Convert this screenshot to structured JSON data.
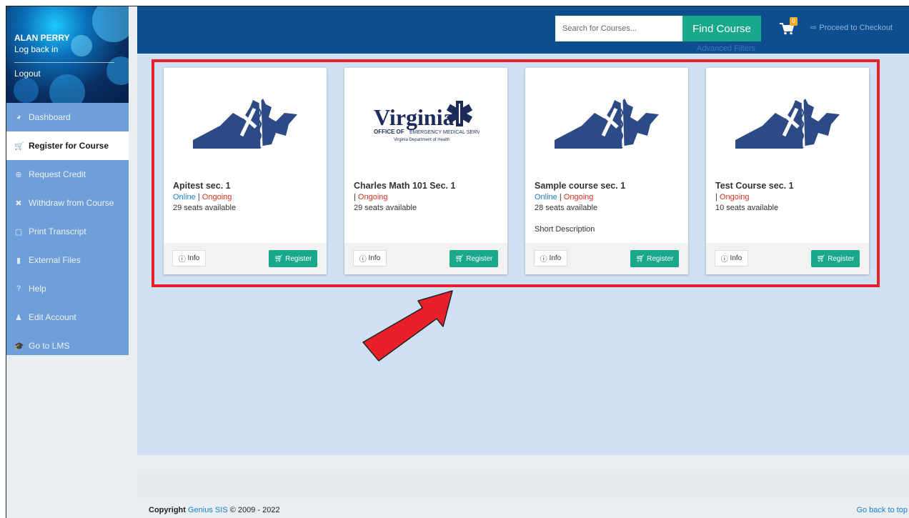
{
  "user": {
    "name": "ALAN PERRY",
    "log_back": "Log back in",
    "logout": "Logout"
  },
  "sidebar": {
    "items": [
      {
        "label": "Dashboard",
        "icon": "dashboard-icon",
        "glyph": "◕",
        "active": false
      },
      {
        "label": "Register for Course",
        "icon": "cart-icon",
        "glyph": "🛒",
        "active": true
      },
      {
        "label": "Request Credit",
        "icon": "plus-circle-icon",
        "glyph": "⊕",
        "active": false
      },
      {
        "label": "Withdraw from Course",
        "icon": "x-icon",
        "glyph": "✖",
        "active": false
      },
      {
        "label": "Print Transcript",
        "icon": "pdf-icon",
        "glyph": "▢",
        "active": false
      },
      {
        "label": "External Files",
        "icon": "file-icon",
        "glyph": "▮",
        "active": false
      },
      {
        "label": "Help",
        "icon": "question-icon",
        "glyph": "?",
        "active": false
      },
      {
        "label": "Edit Account",
        "icon": "user-icon",
        "glyph": "♟",
        "active": false
      },
      {
        "label": "Go to LMS",
        "icon": "graduation-cap-icon",
        "glyph": "🎓",
        "active": false
      }
    ]
  },
  "header": {
    "search_placeholder": "Search for Courses...",
    "find_label": "Find Course",
    "advanced_filters": "Advanced Filters",
    "cart_count": "0",
    "checkout": "Proceed to Checkout"
  },
  "courses": [
    {
      "title": "Apitest sec. 1",
      "online": "Online",
      "ongoing": "Ongoing",
      "seats": "29 seats available",
      "description": "",
      "logo": "va-map-logo"
    },
    {
      "title": "Charles Math 101 Sec. 1",
      "online": "",
      "ongoing": "Ongoing",
      "seats": "29 seats available",
      "description": "",
      "logo": "virginia-oems-logo"
    },
    {
      "title": "Sample course sec. 1",
      "online": "Online",
      "ongoing": "Ongoing",
      "seats": "28 seats available",
      "description": "Short Description",
      "logo": "va-map-logo"
    },
    {
      "title": "Test Course sec. 1",
      "online": "",
      "ongoing": "Ongoing",
      "seats": "10 seats available",
      "description": "",
      "logo": "va-map-logo"
    }
  ],
  "card_buttons": {
    "info": "Info",
    "register": "Register"
  },
  "logo_text": {
    "virginia": "Virginia",
    "office": "OFFICE OF",
    "ems": "EMERGENCY MEDICAL SERVICES",
    "dept": "Virginia Department of Health"
  },
  "footer": {
    "copyright_label": "Copyright",
    "brand": "Genius SIS",
    "years": "© 2009 - 2022",
    "back_to_top": "Go back to top"
  },
  "colors": {
    "accent": "#19a88a",
    "navy": "#0d4e8e",
    "highlight": "#e8202a",
    "content_bg": "#cfe0f2"
  }
}
